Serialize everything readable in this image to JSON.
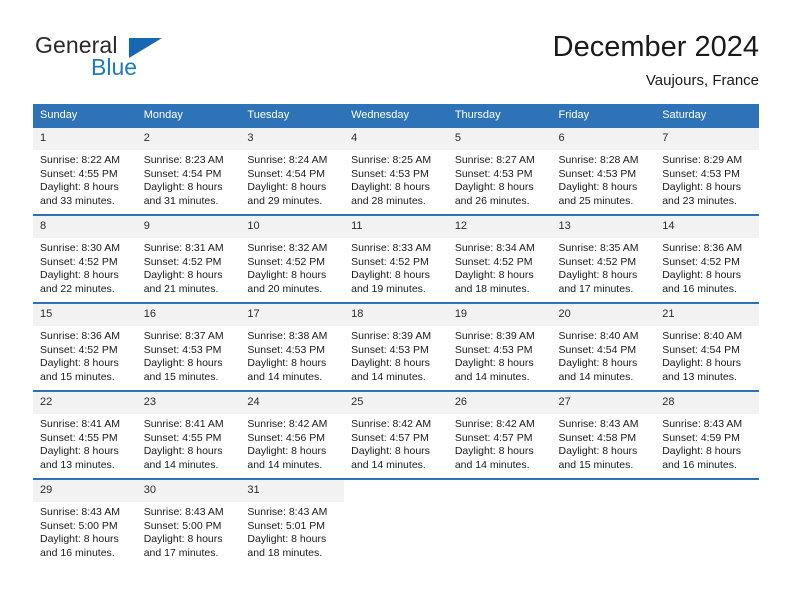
{
  "logo": {
    "text_top": "General",
    "text_bottom": "Blue",
    "triangle_color": "#1668b3",
    "blue_color": "#1f7ac4"
  },
  "header": {
    "title": "December 2024",
    "location": "Vaujours, France"
  },
  "theme": {
    "header_blue": "#2e72b8",
    "daynum_band": "#f2f2f2",
    "text": "#1a1a1a"
  },
  "weekday_headers": [
    "Sunday",
    "Monday",
    "Tuesday",
    "Wednesday",
    "Thursday",
    "Friday",
    "Saturday"
  ],
  "labels": {
    "sunrise": "Sunrise:",
    "sunset": "Sunset:",
    "daylight": "Daylight:"
  },
  "weeks": [
    [
      {
        "day": "1",
        "sunrise": "Sunrise: 8:22 AM",
        "sunset": "Sunset: 4:55 PM",
        "daylight_line1": "Daylight: 8 hours",
        "daylight_line2": "and 33 minutes."
      },
      {
        "day": "2",
        "sunrise": "Sunrise: 8:23 AM",
        "sunset": "Sunset: 4:54 PM",
        "daylight_line1": "Daylight: 8 hours",
        "daylight_line2": "and 31 minutes."
      },
      {
        "day": "3",
        "sunrise": "Sunrise: 8:24 AM",
        "sunset": "Sunset: 4:54 PM",
        "daylight_line1": "Daylight: 8 hours",
        "daylight_line2": "and 29 minutes."
      },
      {
        "day": "4",
        "sunrise": "Sunrise: 8:25 AM",
        "sunset": "Sunset: 4:53 PM",
        "daylight_line1": "Daylight: 8 hours",
        "daylight_line2": "and 28 minutes."
      },
      {
        "day": "5",
        "sunrise": "Sunrise: 8:27 AM",
        "sunset": "Sunset: 4:53 PM",
        "daylight_line1": "Daylight: 8 hours",
        "daylight_line2": "and 26 minutes."
      },
      {
        "day": "6",
        "sunrise": "Sunrise: 8:28 AM",
        "sunset": "Sunset: 4:53 PM",
        "daylight_line1": "Daylight: 8 hours",
        "daylight_line2": "and 25 minutes."
      },
      {
        "day": "7",
        "sunrise": "Sunrise: 8:29 AM",
        "sunset": "Sunset: 4:53 PM",
        "daylight_line1": "Daylight: 8 hours",
        "daylight_line2": "and 23 minutes."
      }
    ],
    [
      {
        "day": "8",
        "sunrise": "Sunrise: 8:30 AM",
        "sunset": "Sunset: 4:52 PM",
        "daylight_line1": "Daylight: 8 hours",
        "daylight_line2": "and 22 minutes."
      },
      {
        "day": "9",
        "sunrise": "Sunrise: 8:31 AM",
        "sunset": "Sunset: 4:52 PM",
        "daylight_line1": "Daylight: 8 hours",
        "daylight_line2": "and 21 minutes."
      },
      {
        "day": "10",
        "sunrise": "Sunrise: 8:32 AM",
        "sunset": "Sunset: 4:52 PM",
        "daylight_line1": "Daylight: 8 hours",
        "daylight_line2": "and 20 minutes."
      },
      {
        "day": "11",
        "sunrise": "Sunrise: 8:33 AM",
        "sunset": "Sunset: 4:52 PM",
        "daylight_line1": "Daylight: 8 hours",
        "daylight_line2": "and 19 minutes."
      },
      {
        "day": "12",
        "sunrise": "Sunrise: 8:34 AM",
        "sunset": "Sunset: 4:52 PM",
        "daylight_line1": "Daylight: 8 hours",
        "daylight_line2": "and 18 minutes."
      },
      {
        "day": "13",
        "sunrise": "Sunrise: 8:35 AM",
        "sunset": "Sunset: 4:52 PM",
        "daylight_line1": "Daylight: 8 hours",
        "daylight_line2": "and 17 minutes."
      },
      {
        "day": "14",
        "sunrise": "Sunrise: 8:36 AM",
        "sunset": "Sunset: 4:52 PM",
        "daylight_line1": "Daylight: 8 hours",
        "daylight_line2": "and 16 minutes."
      }
    ],
    [
      {
        "day": "15",
        "sunrise": "Sunrise: 8:36 AM",
        "sunset": "Sunset: 4:52 PM",
        "daylight_line1": "Daylight: 8 hours",
        "daylight_line2": "and 15 minutes."
      },
      {
        "day": "16",
        "sunrise": "Sunrise: 8:37 AM",
        "sunset": "Sunset: 4:53 PM",
        "daylight_line1": "Daylight: 8 hours",
        "daylight_line2": "and 15 minutes."
      },
      {
        "day": "17",
        "sunrise": "Sunrise: 8:38 AM",
        "sunset": "Sunset: 4:53 PM",
        "daylight_line1": "Daylight: 8 hours",
        "daylight_line2": "and 14 minutes."
      },
      {
        "day": "18",
        "sunrise": "Sunrise: 8:39 AM",
        "sunset": "Sunset: 4:53 PM",
        "daylight_line1": "Daylight: 8 hours",
        "daylight_line2": "and 14 minutes."
      },
      {
        "day": "19",
        "sunrise": "Sunrise: 8:39 AM",
        "sunset": "Sunset: 4:53 PM",
        "daylight_line1": "Daylight: 8 hours",
        "daylight_line2": "and 14 minutes."
      },
      {
        "day": "20",
        "sunrise": "Sunrise: 8:40 AM",
        "sunset": "Sunset: 4:54 PM",
        "daylight_line1": "Daylight: 8 hours",
        "daylight_line2": "and 14 minutes."
      },
      {
        "day": "21",
        "sunrise": "Sunrise: 8:40 AM",
        "sunset": "Sunset: 4:54 PM",
        "daylight_line1": "Daylight: 8 hours",
        "daylight_line2": "and 13 minutes."
      }
    ],
    [
      {
        "day": "22",
        "sunrise": "Sunrise: 8:41 AM",
        "sunset": "Sunset: 4:55 PM",
        "daylight_line1": "Daylight: 8 hours",
        "daylight_line2": "and 13 minutes."
      },
      {
        "day": "23",
        "sunrise": "Sunrise: 8:41 AM",
        "sunset": "Sunset: 4:55 PM",
        "daylight_line1": "Daylight: 8 hours",
        "daylight_line2": "and 14 minutes."
      },
      {
        "day": "24",
        "sunrise": "Sunrise: 8:42 AM",
        "sunset": "Sunset: 4:56 PM",
        "daylight_line1": "Daylight: 8 hours",
        "daylight_line2": "and 14 minutes."
      },
      {
        "day": "25",
        "sunrise": "Sunrise: 8:42 AM",
        "sunset": "Sunset: 4:57 PM",
        "daylight_line1": "Daylight: 8 hours",
        "daylight_line2": "and 14 minutes."
      },
      {
        "day": "26",
        "sunrise": "Sunrise: 8:42 AM",
        "sunset": "Sunset: 4:57 PM",
        "daylight_line1": "Daylight: 8 hours",
        "daylight_line2": "and 14 minutes."
      },
      {
        "day": "27",
        "sunrise": "Sunrise: 8:43 AM",
        "sunset": "Sunset: 4:58 PM",
        "daylight_line1": "Daylight: 8 hours",
        "daylight_line2": "and 15 minutes."
      },
      {
        "day": "28",
        "sunrise": "Sunrise: 8:43 AM",
        "sunset": "Sunset: 4:59 PM",
        "daylight_line1": "Daylight: 8 hours",
        "daylight_line2": "and 16 minutes."
      }
    ],
    [
      {
        "day": "29",
        "sunrise": "Sunrise: 8:43 AM",
        "sunset": "Sunset: 5:00 PM",
        "daylight_line1": "Daylight: 8 hours",
        "daylight_line2": "and 16 minutes."
      },
      {
        "day": "30",
        "sunrise": "Sunrise: 8:43 AM",
        "sunset": "Sunset: 5:00 PM",
        "daylight_line1": "Daylight: 8 hours",
        "daylight_line2": "and 17 minutes."
      },
      {
        "day": "31",
        "sunrise": "Sunrise: 8:43 AM",
        "sunset": "Sunset: 5:01 PM",
        "daylight_line1": "Daylight: 8 hours",
        "daylight_line2": "and 18 minutes."
      },
      {
        "day": "",
        "sunrise": "",
        "sunset": "",
        "daylight_line1": "",
        "daylight_line2": ""
      },
      {
        "day": "",
        "sunrise": "",
        "sunset": "",
        "daylight_line1": "",
        "daylight_line2": ""
      },
      {
        "day": "",
        "sunrise": "",
        "sunset": "",
        "daylight_line1": "",
        "daylight_line2": ""
      },
      {
        "day": "",
        "sunrise": "",
        "sunset": "",
        "daylight_line1": "",
        "daylight_line2": ""
      }
    ]
  ]
}
